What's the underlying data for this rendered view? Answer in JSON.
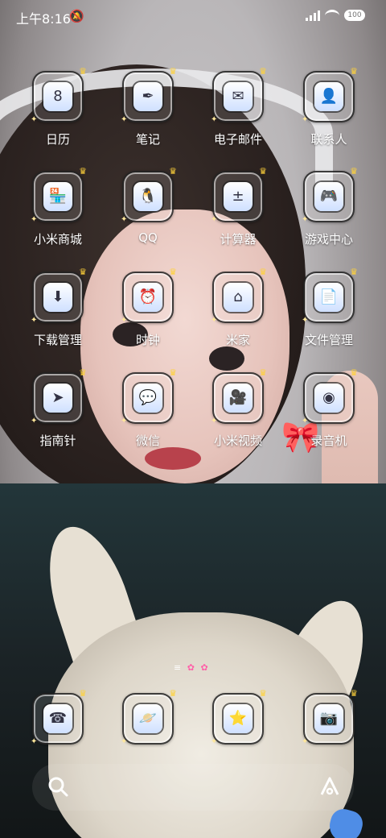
{
  "status": {
    "time": "上午8:16",
    "mute_icon": "bell-off-icon",
    "battery": "100"
  },
  "apps": [
    {
      "label": "日历",
      "icon": "calendar-icon",
      "glyph": "8"
    },
    {
      "label": "笔记",
      "icon": "feather-icon",
      "glyph": "✒"
    },
    {
      "label": "电子邮件",
      "icon": "mail-icon",
      "glyph": "✉"
    },
    {
      "label": "联系人",
      "icon": "contact-card-icon",
      "glyph": "👤"
    },
    {
      "label": "小米商城",
      "icon": "store-icon",
      "glyph": "🏪"
    },
    {
      "label": "QQ",
      "icon": "qq-penguin-icon",
      "glyph": "🐧"
    },
    {
      "label": "计算器",
      "icon": "calculator-icon",
      "glyph": "±"
    },
    {
      "label": "游戏中心",
      "icon": "gamepad-icon",
      "glyph": "🎮"
    },
    {
      "label": "下载管理",
      "icon": "download-cloud-icon",
      "glyph": "⬇"
    },
    {
      "label": "时钟",
      "icon": "clock-icon",
      "glyph": "⏰"
    },
    {
      "label": "米家",
      "icon": "home-icon",
      "glyph": "⌂"
    },
    {
      "label": "文件管理",
      "icon": "folder-icon",
      "glyph": "📄"
    },
    {
      "label": "指南针",
      "icon": "compass-icon",
      "glyph": "➤"
    },
    {
      "label": "微信",
      "icon": "chat-bubble-icon",
      "glyph": "💬"
    },
    {
      "label": "小米视频",
      "icon": "video-camera-icon",
      "glyph": "🎥"
    },
    {
      "label": "录音机",
      "icon": "recorder-icon",
      "glyph": "◉"
    }
  ],
  "dock": [
    {
      "icon": "phone-icon",
      "glyph": "☎"
    },
    {
      "icon": "browser-planet-icon",
      "glyph": "🪐"
    },
    {
      "icon": "messages-icon",
      "glyph": "⭐"
    },
    {
      "icon": "camera-icon",
      "glyph": "📷"
    }
  ],
  "search": {
    "icon": "search-icon",
    "assistant_icon": "assistant-icon"
  }
}
